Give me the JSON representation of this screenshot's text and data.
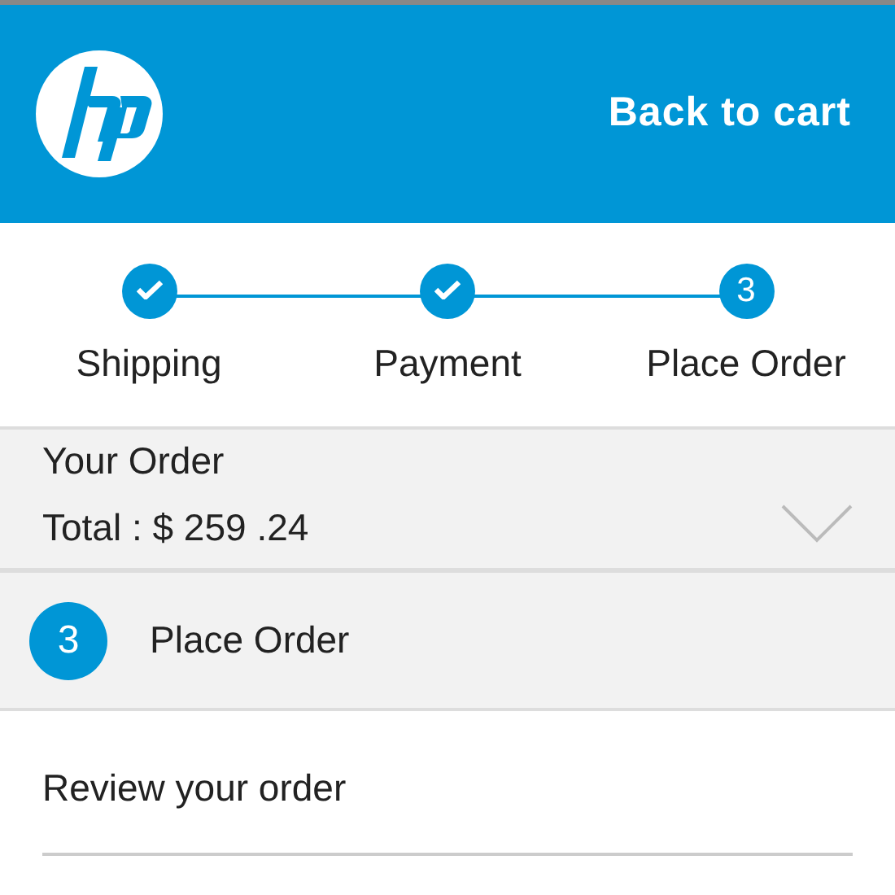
{
  "header": {
    "back_link": "Back to cart"
  },
  "steps": [
    {
      "label": "Shipping",
      "completed": true
    },
    {
      "label": "Payment",
      "completed": true
    },
    {
      "label": "Place Order",
      "completed": false,
      "number": "3"
    }
  ],
  "order_summary": {
    "title": "Your Order",
    "total": "Total : $ 259 .24",
    "expanded": false
  },
  "section": {
    "number": "3",
    "title": "Place Order"
  },
  "subsection": {
    "title": "Review your order"
  }
}
